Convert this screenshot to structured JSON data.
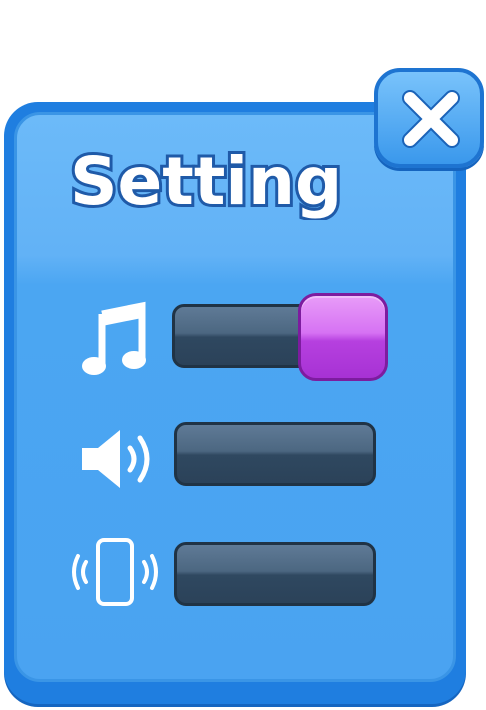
{
  "dialog": {
    "title": "Setting",
    "close_icon": "close-x-icon"
  },
  "settings": [
    {
      "id": "music",
      "icon": "music-note-icon",
      "value": 1.0
    },
    {
      "id": "sound",
      "icon": "speaker-icon",
      "value": 0.0
    },
    {
      "id": "vibration",
      "icon": "phone-vibrate-icon",
      "value": 0.0
    }
  ],
  "colors": {
    "panel": "#4aa3f1",
    "panel_border": "#1f7ee0",
    "knob": "#d672f3",
    "track": "#2f4860"
  }
}
